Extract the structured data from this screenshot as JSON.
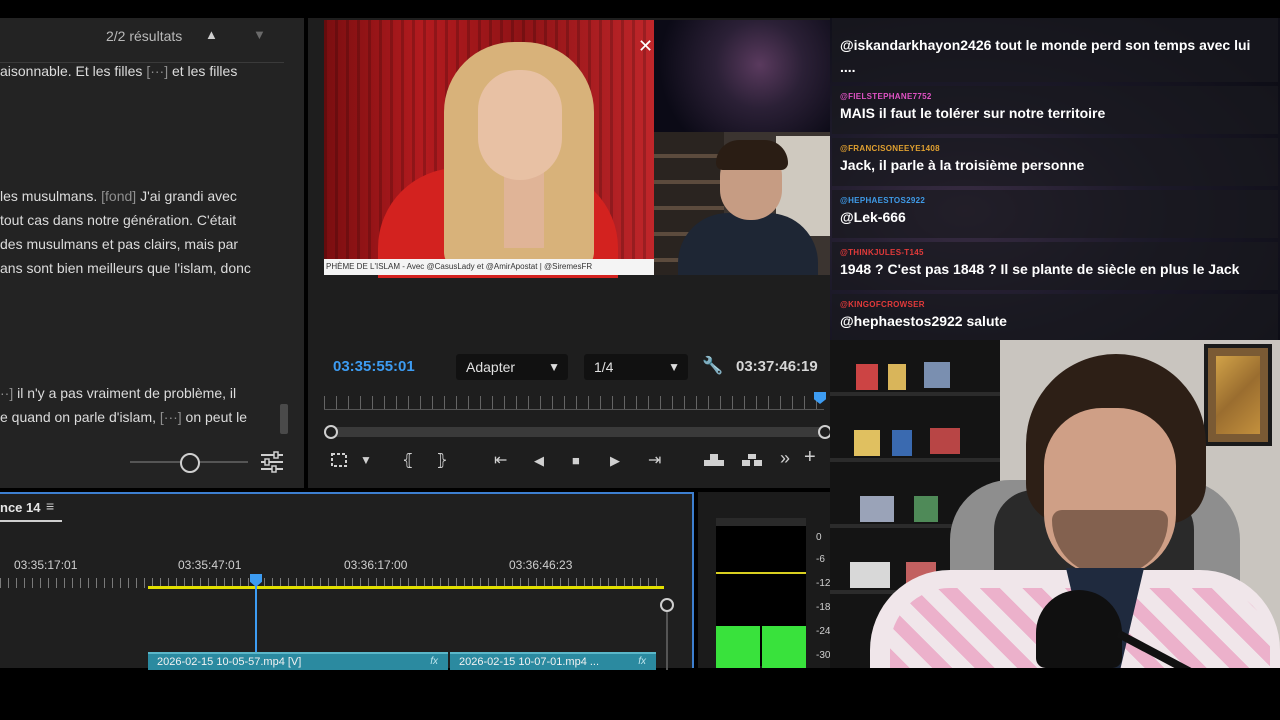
{
  "transcript": {
    "results": "2/2 résultats",
    "up_icon": "chevron-up-icon",
    "down_icon": "chevron-down-icon",
    "lines": [
      {
        "pre": "aisonnable. Et les filles ",
        "tag": "[···]",
        "post": " et les filles"
      },
      {
        "pre": " les musulmans. ",
        "tag": "[fond]",
        "post": " J'ai grandi avec"
      },
      {
        "pre": " tout cas dans notre génération. C'était",
        "tag": "",
        "post": ""
      },
      {
        "pre": "des musulmans et pas clairs, mais par",
        "tag": "",
        "post": ""
      },
      {
        "pre": "ans sont bien meilleurs que l'islam, donc",
        "tag": "",
        "post": ""
      },
      {
        "pre": "",
        "tag": "··]",
        "post": " il n'y a pas vraiment de problème, il"
      },
      {
        "pre": "e quand on parle d'islam, ",
        "tag": "[···]",
        "post": " on peut le"
      }
    ]
  },
  "monitor": {
    "video_caption": "PHÈME DE L'ISLAM - Avec @CasusLady et @AmirApostat | @SiremesFR",
    "timecode_current": "03:35:55:01",
    "fit_label": "Adapter",
    "resolution_label": "1/4",
    "timecode_duration": "03:37:46:19",
    "controls": {
      "mark_in": "⦃",
      "mark_out": "⦄",
      "go_in": "⇤",
      "step_back": "◀",
      "stop": "■",
      "step_forward": "▶",
      "go_out": "⇥",
      "more": "»",
      "add": "+"
    }
  },
  "timeline": {
    "sequence_tab": "nce 14",
    "times": [
      "03:35:17:01",
      "03:35:47:01",
      "03:36:17:00",
      "03:36:46:23"
    ],
    "clips": [
      {
        "label": "2026-02-15 10-05-57.mp4 [V]",
        "fx": "fx"
      },
      {
        "label": "2026-02-15 10-07-01.mp4 ...",
        "fx": "fx"
      }
    ]
  },
  "audio_meter": {
    "labels": [
      "0",
      "-6",
      "-12",
      "-18",
      "-24",
      "-30"
    ]
  },
  "chat": {
    "messages": [
      {
        "user": "",
        "user_color": "#d94040",
        "text": "@iskandarkhayon2426 tout le monde perd son temps avec lui",
        "text2": "...."
      },
      {
        "user": "@FIELSTEPHANE7752",
        "user_color": "#e052c4",
        "text": "MAIS il faut le tolérer sur notre territoire",
        "text2": ""
      },
      {
        "user": "@FRANCISONEEYE1408",
        "user_color": "#e0a030",
        "text": "Jack, il parle à la troisième personne",
        "text2": ""
      },
      {
        "user": "@HEPHAESTOS2922",
        "user_color": "#3f9be8",
        "text": "@Lek-666",
        "text2": ""
      },
      {
        "user": "@THINKJULES-T145",
        "user_color": "#e23a3a",
        "text": "1948 ? C'est pas 1848 ? Il se plante de siècle en plus le Jack",
        "text2": ""
      },
      {
        "user": "@KINGOFCROWSER",
        "user_color": "#e23a3a",
        "text": "@hephaestos2922 salute",
        "text2": ""
      }
    ]
  }
}
